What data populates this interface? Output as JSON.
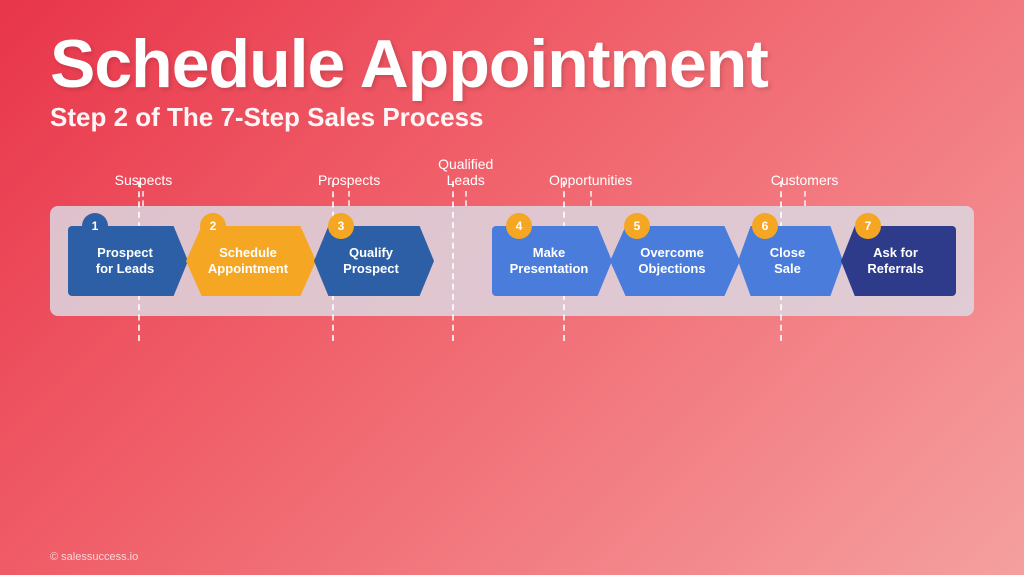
{
  "header": {
    "title": "Schedule Appointment",
    "subtitle": "Step 2 of The 7-Step Sales Process"
  },
  "categories": [
    {
      "id": "suspects",
      "label": "Suspects",
      "left_pct": 9
    },
    {
      "id": "prospects",
      "label": "Prospects",
      "left_pct": 31
    },
    {
      "id": "qualified_leads",
      "label": "Qualified\nLeads",
      "left_pct": 44.5
    },
    {
      "id": "opportunities",
      "label": "Opportunities",
      "left_pct": 57
    },
    {
      "id": "customers",
      "label": "Customers",
      "left_pct": 80
    }
  ],
  "steps": [
    {
      "id": 1,
      "number": "1",
      "label": "Prospect\nfor Leads",
      "color": "blue",
      "shape": "first"
    },
    {
      "id": 2,
      "number": "2",
      "label": "Schedule\nAppointment",
      "color": "orange",
      "shape": "notched"
    },
    {
      "id": 3,
      "number": "3",
      "label": "Qualify\nProspect",
      "color": "blue",
      "shape": "notched"
    },
    {
      "id": 4,
      "number": "4",
      "label": "Make\nPresentation",
      "color": "mid-blue",
      "shape": "notched"
    },
    {
      "id": 5,
      "number": "5",
      "label": "Overcome\nObjections",
      "color": "mid-blue",
      "shape": "notched"
    },
    {
      "id": 6,
      "number": "6",
      "label": "Close\nSale",
      "color": "mid-blue",
      "shape": "notched"
    },
    {
      "id": 7,
      "number": "7",
      "label": "Ask for\nReferrals",
      "color": "blue",
      "shape": "last"
    }
  ],
  "copyright": "© salessuccess.io",
  "dashed_positions": [
    9,
    31,
    44.5,
    57,
    80
  ]
}
